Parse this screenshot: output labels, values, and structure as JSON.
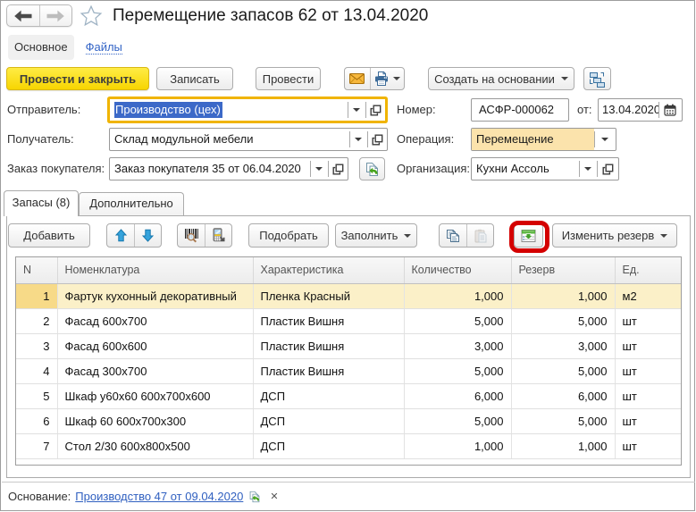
{
  "window": {
    "title": "Перемещение запасов 62 от 13.04.2020"
  },
  "nav_tabs": {
    "main": "Основное",
    "files": "Файлы"
  },
  "command_bar": {
    "post_and_close": "Провести и закрыть",
    "write": "Записать",
    "post": "Провести",
    "create_based_on": "Создать на основании"
  },
  "fields": {
    "sender": {
      "label": "Отправитель:",
      "value": "Производство (цех)"
    },
    "receiver": {
      "label": "Получатель:",
      "value": "Склад модульной мебели"
    },
    "customer_order": {
      "label": "Заказ покупателя:",
      "value": "Заказ покупателя 35 от 06.04.2020"
    },
    "number": {
      "label": "Номер:",
      "value": "АСФР-000062"
    },
    "date": {
      "label": "от:",
      "value": "13.04.2020"
    },
    "operation": {
      "label": "Операция:",
      "value": "Перемещение"
    },
    "organization": {
      "label": "Организация:",
      "value": "Кухни Ассоль"
    }
  },
  "page_tabs": {
    "stock": "Запасы (8)",
    "additional": "Дополнительно"
  },
  "items_toolbar": {
    "add": "Добавить",
    "pick": "Подобрать",
    "fill": "Заполнить",
    "change_reserve": "Изменить резерв"
  },
  "items_table": {
    "columns": [
      "N",
      "Номенклатура",
      "Характеристика",
      "Количество",
      "Резерв",
      "Ед."
    ],
    "rows": [
      [
        "1",
        "Фартук кухонный декоративный",
        "Пленка Красный",
        "1,000",
        "1,000",
        "м2"
      ],
      [
        "2",
        "Фасад 600х700",
        "Пластик Вишня",
        "5,000",
        "5,000",
        "шт"
      ],
      [
        "3",
        "Фасад 600х600",
        "Пластик Вишня",
        "3,000",
        "3,000",
        "шт"
      ],
      [
        "4",
        "Фасад 300х700",
        "Пластик Вишня",
        "5,000",
        "5,000",
        "шт"
      ],
      [
        "5",
        "Шкаф у60х60 600х700х600",
        "ДСП",
        "6,000",
        "6,000",
        "шт"
      ],
      [
        "6",
        "Шкаф 60 600х700х300",
        "ДСП",
        "5,000",
        "5,000",
        "шт"
      ],
      [
        "7",
        "Стол 2/30 600х800х500",
        "ДСП",
        "1,000",
        "1,000",
        "шт"
      ]
    ],
    "selected_row_index": 0
  },
  "footer": {
    "label": "Основание:",
    "link": "Производство 47 от 09.04.2020",
    "clear": "✕"
  },
  "colors": {
    "accent_yellow": "#f7d501",
    "focus_border": "#f2b800",
    "selected_row": "#fbf0c8",
    "selected_row_number_cell": "#f7da88",
    "operation_field_bg": "#ffe1a3",
    "link_blue": "#3364c6",
    "annotation_red": "#d40000"
  }
}
